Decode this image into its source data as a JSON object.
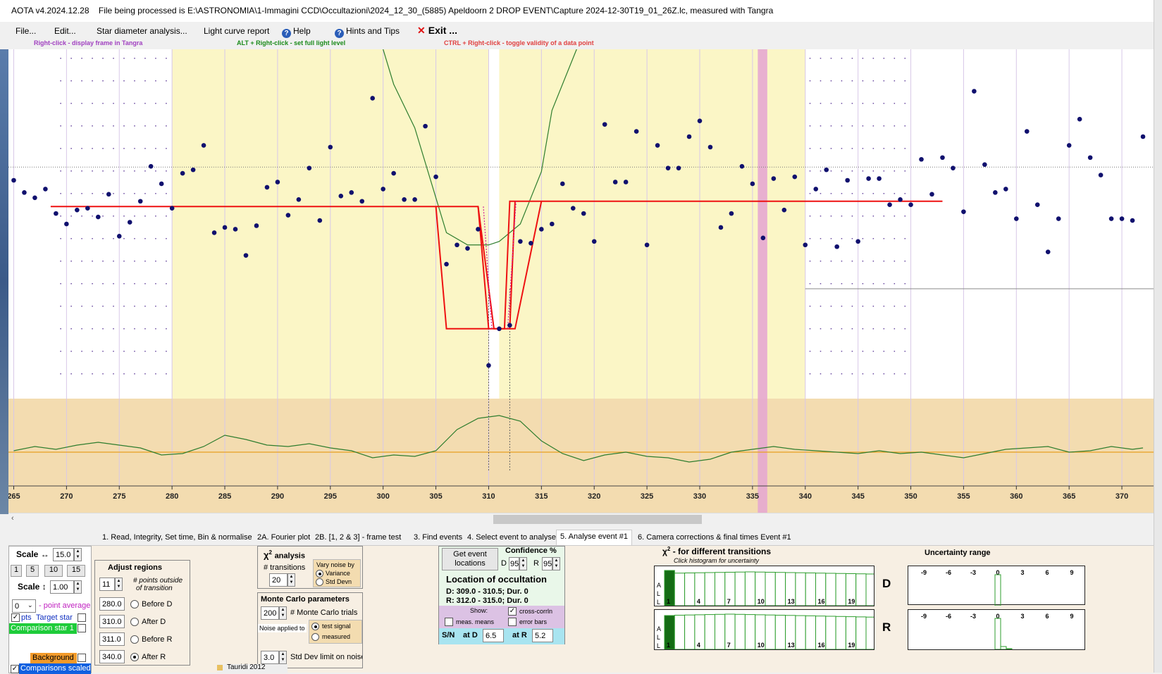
{
  "window": {
    "title": "AOTA v4.2024.12.28",
    "file_info": "File being processed is E:\\ASTRONOMIA\\1-Immagini CCD\\Occultazioni\\2024_12_30_(5885) Apeldoorn 2 DROP EVENT\\Capture 2024-12-30T19_01_26Z.lc, measured with Tangra"
  },
  "menu": {
    "file": "File...",
    "edit": "Edit...",
    "star_diameter": "Star diameter analysis...",
    "light_curve": "Light curve report",
    "help": "Help",
    "hints": "Hints and Tips",
    "exit": "Exit ..."
  },
  "hints": {
    "right_click": "Right-click  -  display frame in Tangra",
    "alt_right_click": "ALT + Right-click  -  set full light level",
    "ctrl_right_click": "CTRL + Right-click  -  toggle validity of a data point"
  },
  "colors": {
    "hint_purple": "#a040c0",
    "hint_green": "#1a8a1a",
    "hint_red": "#e04040",
    "yellow_region": "#fbf6c6",
    "noise_band": "#f3dcb0",
    "pink_marker": "#e6a8d0",
    "model_red": "#ee1111",
    "chi2_green": "#2e7d2e",
    "point_navy": "#10106e"
  },
  "tabs": [
    "1. Read, Integrity, Set time, Bin & normalise",
    "2A. Fourier plot",
    "2B. [1, 2 & 3] - frame test",
    "3. Find events",
    "4. Select event to analyse",
    "5. Analyse event #1",
    "6. Camera corrections & final times Event #1"
  ],
  "active_tab": "5. Analyse event #1",
  "scale_panel": {
    "scale_h_label": "Scale ↔",
    "scale_h_value": "15.0",
    "buttons": [
      "1",
      "5",
      "10",
      "15"
    ],
    "scale_v_label": "Scale ↕",
    "scale_v_value": "1.00",
    "point_avg_value": "0",
    "point_avg_label": "- point average",
    "pts_label": "pts",
    "target_star": "Target star",
    "comparison": "Comparison star 1",
    "background": "Background",
    "comparisons_scaled": "Comparisons scaled"
  },
  "adjust_regions": {
    "title": "Adjust regions",
    "points_value": "11",
    "points_label": "# points outside",
    "points_label2": "of transition",
    "rows": [
      {
        "value": "280.0",
        "label": "Before D",
        "selected": false
      },
      {
        "value": "310.0",
        "label": "After D",
        "selected": false
      },
      {
        "value": "311.0",
        "label": "Before R",
        "selected": false
      },
      {
        "value": "340.0",
        "label": "After R",
        "selected": true
      }
    ]
  },
  "chi2_analysis": {
    "title": "χ",
    "title_sup": "2",
    "title_rest": "analysis",
    "transitions_label": "# transitions",
    "transitions_value": "20",
    "vary_noise_label": "Vary noise by",
    "variance": "Variance",
    "std_devn": "Std Devn",
    "variance_selected": true
  },
  "monte_carlo": {
    "title": "Monte Carlo parameters",
    "trials_value": "200",
    "trials_label": "# Monte Carlo trials",
    "noise_applied": "Noise applied to",
    "test_signal": "test signal",
    "measured": "measured",
    "std_limit_value": "3.0",
    "std_limit_label": "Std Dev limit on noise"
  },
  "location": {
    "get_event_btn_line1": "Get event",
    "get_event_btn_line2": "locations",
    "confidence_label": "Confidence %",
    "d_label": "D",
    "d_value": "95",
    "r_label": "R",
    "r_value": "95",
    "title": "Location of occultation",
    "d_result": "D: 309.0 - 310.5; Dur. 0",
    "r_result": "R: 312.0 - 315.0; Dur. 0",
    "show_label": "Show:",
    "cross_corrln": "cross-corrln",
    "meas_means": "meas. means",
    "error_bars": "error bars",
    "sn_label": "S/N",
    "at_d_label": "at D",
    "at_d_value": "6.5",
    "at_r_label": "at R",
    "at_r_value": "5.2"
  },
  "chi2_hist": {
    "title": "χ",
    "title_sup": "2",
    "title_rest": " - for different transitions",
    "subtitle": "Click histogram for uncertainty",
    "side_letters": [
      "A",
      "L",
      "L"
    ],
    "ticks": [
      "1",
      "4",
      "7",
      "10",
      "13",
      "16",
      "19"
    ],
    "d_label": "D",
    "r_label": "R"
  },
  "uncertainty": {
    "title": "Uncertainty range",
    "ticks": [
      "-9",
      "-6",
      "-3",
      "0",
      "3",
      "6",
      "9"
    ]
  },
  "taskbar_text": "Tauridi 2012",
  "chart_data": {
    "type": "scatter",
    "xlim": [
      264.5,
      373
    ],
    "x_ticks": [
      265,
      270,
      275,
      280,
      285,
      290,
      295,
      300,
      305,
      310,
      315,
      320,
      325,
      330,
      335,
      340,
      345,
      350,
      355,
      360,
      365,
      370
    ],
    "ylim": [
      -0.6,
      1.9
    ],
    "full_light_level": 1.0,
    "yellow_regions": [
      [
        280.0,
        310.0
      ],
      [
        311.0,
        340.0
      ]
    ],
    "pink_marker": [
      335.5,
      336.4
    ],
    "points": [
      [
        265,
        1.15
      ],
      [
        266,
        1.08
      ],
      [
        267,
        1.05
      ],
      [
        268,
        1.1
      ],
      [
        269,
        0.96
      ],
      [
        270,
        0.9
      ],
      [
        271,
        0.98
      ],
      [
        272,
        0.99
      ],
      [
        273,
        0.94
      ],
      [
        274,
        1.07
      ],
      [
        275,
        0.83
      ],
      [
        276,
        0.91
      ],
      [
        277,
        1.03
      ],
      [
        278,
        1.23
      ],
      [
        279,
        1.13
      ],
      [
        280,
        0.99
      ],
      [
        281,
        1.19
      ],
      [
        282,
        1.21
      ],
      [
        283,
        1.35
      ],
      [
        284,
        0.85
      ],
      [
        285,
        0.88
      ],
      [
        286,
        0.87
      ],
      [
        287,
        0.72
      ],
      [
        288,
        0.89
      ],
      [
        289,
        1.11
      ],
      [
        290,
        1.14
      ],
      [
        291,
        0.95
      ],
      [
        292,
        1.04
      ],
      [
        293,
        1.22
      ],
      [
        294,
        0.92
      ],
      [
        295,
        1.34
      ],
      [
        296,
        1.06
      ],
      [
        297,
        1.08
      ],
      [
        298,
        1.03
      ],
      [
        299,
        1.62
      ],
      [
        300,
        1.1
      ],
      [
        301,
        1.19
      ],
      [
        302,
        1.04
      ],
      [
        303,
        1.04
      ],
      [
        304,
        1.46
      ],
      [
        305,
        1.17
      ],
      [
        306,
        0.67
      ],
      [
        307,
        0.78
      ],
      [
        308,
        0.76
      ],
      [
        309,
        0.87
      ],
      [
        310,
        0.09
      ],
      [
        311,
        0.3
      ],
      [
        312,
        0.32
      ],
      [
        313,
        0.8
      ],
      [
        314,
        0.79
      ],
      [
        315,
        0.87
      ],
      [
        316,
        0.9
      ],
      [
        317,
        1.13
      ],
      [
        318,
        0.99
      ],
      [
        319,
        0.96
      ],
      [
        320,
        0.8
      ],
      [
        321,
        1.47
      ],
      [
        322,
        1.14
      ],
      [
        323,
        1.14
      ],
      [
        324,
        1.43
      ],
      [
        325,
        0.78
      ],
      [
        326,
        1.35
      ],
      [
        327,
        1.22
      ],
      [
        328,
        1.22
      ],
      [
        329,
        1.4
      ],
      [
        330,
        1.49
      ],
      [
        331,
        1.34
      ],
      [
        332,
        0.88
      ],
      [
        333,
        0.96
      ],
      [
        334,
        1.23
      ],
      [
        335,
        1.13
      ],
      [
        336,
        0.82
      ],
      [
        337,
        1.16
      ],
      [
        338,
        0.98
      ],
      [
        339,
        1.17
      ],
      [
        340,
        0.78
      ],
      [
        341,
        1.1
      ],
      [
        342,
        1.21
      ],
      [
        343,
        0.77
      ],
      [
        344,
        1.15
      ],
      [
        345,
        0.8
      ],
      [
        346,
        1.16
      ],
      [
        347,
        1.16
      ],
      [
        348,
        1.01
      ],
      [
        349,
        1.04
      ],
      [
        350,
        1.01
      ],
      [
        351,
        1.27
      ],
      [
        352,
        1.07
      ],
      [
        353,
        1.28
      ],
      [
        354,
        1.22
      ],
      [
        355,
        0.97
      ],
      [
        356,
        1.66
      ],
      [
        357,
        1.24
      ],
      [
        358,
        1.08
      ],
      [
        359,
        1.1
      ],
      [
        360,
        0.93
      ],
      [
        361,
        1.43
      ],
      [
        362,
        1.01
      ],
      [
        363,
        0.74
      ],
      [
        364,
        0.93
      ],
      [
        365,
        1.35
      ],
      [
        366,
        1.5
      ],
      [
        367,
        1.28
      ],
      [
        368,
        1.18
      ],
      [
        369,
        0.93
      ],
      [
        370,
        0.93
      ],
      [
        371,
        0.92
      ],
      [
        372,
        1.4
      ]
    ],
    "model_curve": [
      [
        268.5,
        1.0
      ],
      [
        309.0,
        1.0
      ],
      [
        310.5,
        0.3
      ],
      [
        311.5,
        0.3
      ],
      [
        312.0,
        1.03
      ],
      [
        353.0,
        1.03
      ]
    ],
    "model_band": {
      "outer": [
        [
          305.0,
          1.0
        ],
        [
          306.0,
          0.3
        ],
        [
          312.5,
          0.3
        ],
        [
          315.0,
          1.03
        ]
      ],
      "inner_d": [
        [
          309.0,
          1.0
        ],
        [
          310.0,
          0.3
        ]
      ],
      "inner_r": [
        [
          312.0,
          0.3
        ],
        [
          312.5,
          1.03
        ]
      ]
    },
    "chi2_curve": [
      [
        299.5,
        2.0
      ],
      [
        301,
        1.7
      ],
      [
        303,
        1.45
      ],
      [
        305,
        1.05
      ],
      [
        306,
        0.85
      ],
      [
        308,
        0.78
      ],
      [
        310,
        0.78
      ],
      [
        311,
        0.8
      ],
      [
        313,
        0.9
      ],
      [
        314,
        1.05
      ],
      [
        315,
        1.2
      ],
      [
        316,
        1.55
      ],
      [
        318,
        1.85
      ],
      [
        319,
        2.0
      ]
    ],
    "noise_curve": [
      [
        265,
        0.35
      ],
      [
        267,
        0.38
      ],
      [
        269,
        0.36
      ],
      [
        271,
        0.39
      ],
      [
        273,
        0.41
      ],
      [
        275,
        0.39
      ],
      [
        277,
        0.37
      ],
      [
        279,
        0.32
      ],
      [
        281,
        0.33
      ],
      [
        283,
        0.38
      ],
      [
        285,
        0.46
      ],
      [
        287,
        0.43
      ],
      [
        289,
        0.39
      ],
      [
        291,
        0.38
      ],
      [
        293,
        0.4
      ],
      [
        295,
        0.37
      ],
      [
        297,
        0.35
      ],
      [
        299,
        0.3
      ],
      [
        301,
        0.32
      ],
      [
        303,
        0.31
      ],
      [
        305,
        0.35
      ],
      [
        307,
        0.5
      ],
      [
        309,
        0.58
      ],
      [
        311,
        0.6
      ],
      [
        313,
        0.56
      ],
      [
        315,
        0.42
      ],
      [
        317,
        0.33
      ],
      [
        319,
        0.28
      ],
      [
        321,
        0.32
      ],
      [
        323,
        0.34
      ],
      [
        325,
        0.31
      ],
      [
        327,
        0.3
      ],
      [
        329,
        0.27
      ],
      [
        331,
        0.29
      ],
      [
        333,
        0.34
      ],
      [
        335,
        0.36
      ],
      [
        337,
        0.38
      ],
      [
        339,
        0.36
      ],
      [
        341,
        0.35
      ],
      [
        343,
        0.34
      ],
      [
        345,
        0.33
      ],
      [
        347,
        0.35
      ],
      [
        349,
        0.33
      ],
      [
        351,
        0.34
      ],
      [
        353,
        0.32
      ],
      [
        355,
        0.3
      ],
      [
        357,
        0.33
      ],
      [
        359,
        0.36
      ],
      [
        361,
        0.37
      ],
      [
        363,
        0.38
      ],
      [
        365,
        0.34
      ],
      [
        367,
        0.35
      ],
      [
        369,
        0.38
      ],
      [
        371,
        0.36
      ],
      [
        372,
        0.37
      ]
    ]
  }
}
